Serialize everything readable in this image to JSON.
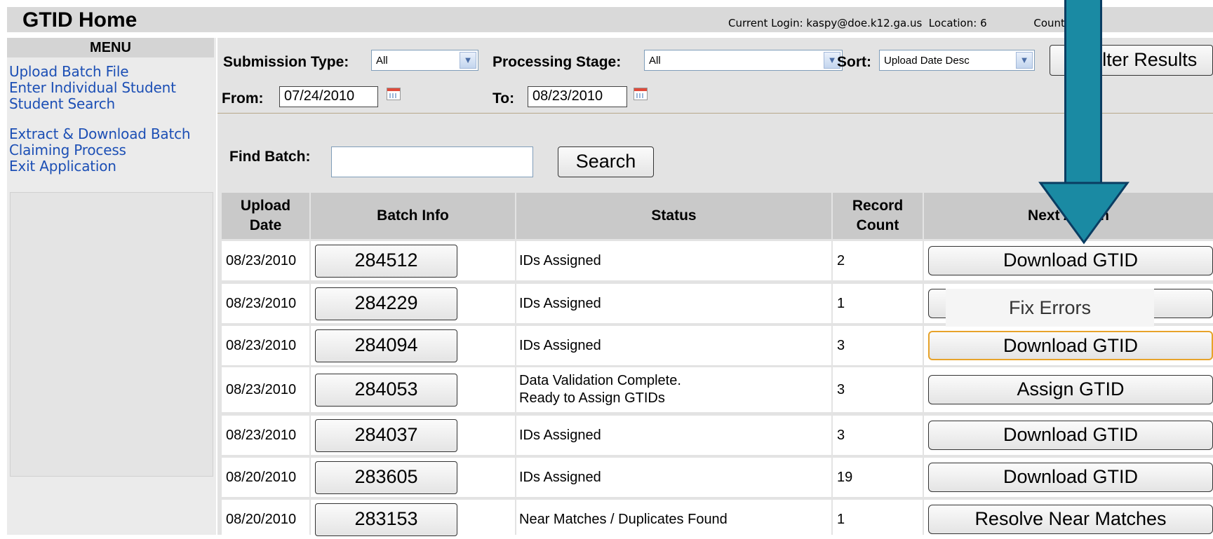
{
  "header": {
    "title": "GTID Home",
    "login_info": "Current Login: kaspy@doe.k12.ga.us  Location: 6              County"
  },
  "menu": {
    "heading": "MENU",
    "items": [
      "Upload Batch File",
      "Enter Individual Student",
      "Student Search",
      "Extract & Download Batch",
      "Claiming Process",
      "Exit Application"
    ]
  },
  "filters": {
    "submission_type_label": "Submission Type:",
    "submission_type_value": "All",
    "processing_stage_label": "Processing Stage:",
    "processing_stage_value": "All",
    "sort_label": "Sort:",
    "sort_value": "Upload Date Desc",
    "filter_button": "Filter Results",
    "from_label": "From:",
    "from_value": "07/24/2010",
    "to_label": "To:",
    "to_value": "08/23/2010"
  },
  "find_batch": {
    "label": "Find Batch:",
    "value": "",
    "search_button": "Search"
  },
  "table": {
    "headers": [
      "Upload Date",
      "Batch Info",
      "Status",
      "Record Count",
      "Next Action"
    ],
    "rows": [
      {
        "date": "08/23/2010",
        "batch": "284512",
        "status": "IDs Assigned",
        "count": "2",
        "action": "Download GTID"
      },
      {
        "date": "08/23/2010",
        "batch": "284229",
        "status": "IDs Assigned",
        "count": "1",
        "action": "Fix Errors"
      },
      {
        "date": "08/23/2010",
        "batch": "284094",
        "status": "IDs Assigned",
        "count": "3",
        "action": "Download GTID"
      },
      {
        "date": "08/23/2010",
        "batch": "284053",
        "status": "Data Validation Complete. Ready to Assign GTIDs",
        "count": "3",
        "action": "Assign GTID"
      },
      {
        "date": "08/23/2010",
        "batch": "284037",
        "status": "IDs Assigned",
        "count": "3",
        "action": "Download GTID"
      },
      {
        "date": "08/20/2010",
        "batch": "283605",
        "status": "IDs Assigned",
        "count": "19",
        "action": "Download GTID"
      },
      {
        "date": "08/20/2010",
        "batch": "283153",
        "status": "Near Matches / Duplicates Found",
        "count": "1",
        "action": "Resolve Near Matches"
      }
    ]
  },
  "colors": {
    "link": "#1c4fb5",
    "arrow_fill": "#1a8aa3",
    "arrow_outline": "#0a3d62",
    "focus_border": "#e7a32a"
  }
}
